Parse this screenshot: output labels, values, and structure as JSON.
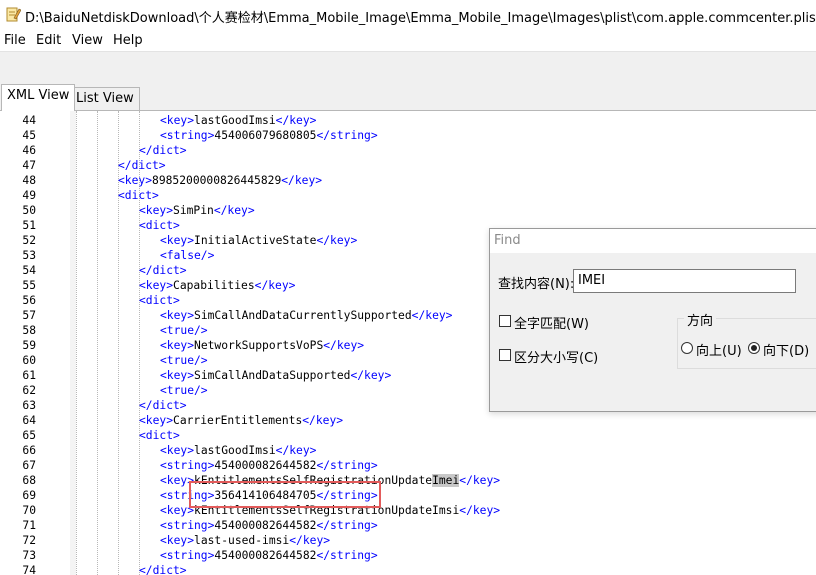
{
  "window": {
    "title": "D:\\BaiduNetdiskDownload\\个人赛检材\\Emma_Mobile_Image\\Emma_Mobile_Image\\Images\\plist\\com.apple.commcenter.plist",
    "icon": "notepad-pencil-icon"
  },
  "menu": {
    "file": "File",
    "edit": "Edit",
    "view": "View",
    "help": "Help"
  },
  "tabs": {
    "xml": "XML View",
    "list": "List View"
  },
  "editor": {
    "lines": [
      {
        "n": "44",
        "d": 3,
        "parts": [
          [
            "t",
            "<key>"
          ],
          [
            "x",
            "lastGoodImsi"
          ],
          [
            "t",
            "</key>"
          ]
        ]
      },
      {
        "n": "45",
        "d": 3,
        "parts": [
          [
            "t",
            "<string>"
          ],
          [
            "x",
            "454006079680805"
          ],
          [
            "t",
            "</string>"
          ]
        ]
      },
      {
        "n": "46",
        "d": 2,
        "parts": [
          [
            "t",
            "</dict>"
          ]
        ]
      },
      {
        "n": "47",
        "d": 1,
        "parts": [
          [
            "t",
            "</dict>"
          ]
        ]
      },
      {
        "n": "48",
        "d": 1,
        "parts": [
          [
            "t",
            "<key>"
          ],
          [
            "x",
            "8985200000826445829"
          ],
          [
            "t",
            "</key>"
          ]
        ]
      },
      {
        "n": "49",
        "d": 1,
        "parts": [
          [
            "t",
            "<dict>"
          ]
        ]
      },
      {
        "n": "50",
        "d": 2,
        "parts": [
          [
            "t",
            "<key>"
          ],
          [
            "x",
            "SimPin"
          ],
          [
            "t",
            "</key>"
          ]
        ]
      },
      {
        "n": "51",
        "d": 2,
        "parts": [
          [
            "t",
            "<dict>"
          ]
        ]
      },
      {
        "n": "52",
        "d": 3,
        "parts": [
          [
            "t",
            "<key>"
          ],
          [
            "x",
            "InitialActiveState"
          ],
          [
            "t",
            "</key>"
          ]
        ]
      },
      {
        "n": "53",
        "d": 3,
        "parts": [
          [
            "t",
            "<false/>"
          ]
        ]
      },
      {
        "n": "54",
        "d": 2,
        "parts": [
          [
            "t",
            "</dict>"
          ]
        ]
      },
      {
        "n": "55",
        "d": 2,
        "parts": [
          [
            "t",
            "<key>"
          ],
          [
            "x",
            "Capabilities"
          ],
          [
            "t",
            "</key>"
          ]
        ]
      },
      {
        "n": "56",
        "d": 2,
        "parts": [
          [
            "t",
            "<dict>"
          ]
        ]
      },
      {
        "n": "57",
        "d": 3,
        "parts": [
          [
            "t",
            "<key>"
          ],
          [
            "x",
            "SimCallAndDataCurrentlySupported"
          ],
          [
            "t",
            "</key>"
          ]
        ]
      },
      {
        "n": "58",
        "d": 3,
        "parts": [
          [
            "t",
            "<true/>"
          ]
        ]
      },
      {
        "n": "59",
        "d": 3,
        "parts": [
          [
            "t",
            "<key>"
          ],
          [
            "x",
            "NetworkSupportsVoPS"
          ],
          [
            "t",
            "</key>"
          ]
        ]
      },
      {
        "n": "60",
        "d": 3,
        "parts": [
          [
            "t",
            "<true/>"
          ]
        ]
      },
      {
        "n": "61",
        "d": 3,
        "parts": [
          [
            "t",
            "<key>"
          ],
          [
            "x",
            "SimCallAndDataSupported"
          ],
          [
            "t",
            "</key>"
          ]
        ]
      },
      {
        "n": "62",
        "d": 3,
        "parts": [
          [
            "t",
            "<true/>"
          ]
        ]
      },
      {
        "n": "63",
        "d": 2,
        "parts": [
          [
            "t",
            "</dict>"
          ]
        ]
      },
      {
        "n": "64",
        "d": 2,
        "parts": [
          [
            "t",
            "<key>"
          ],
          [
            "x",
            "CarrierEntitlements"
          ],
          [
            "t",
            "</key>"
          ]
        ]
      },
      {
        "n": "65",
        "d": 2,
        "parts": [
          [
            "t",
            "<dict>"
          ]
        ]
      },
      {
        "n": "66",
        "d": 3,
        "parts": [
          [
            "t",
            "<key>"
          ],
          [
            "x",
            "lastGoodImsi"
          ],
          [
            "t",
            "</key>"
          ]
        ]
      },
      {
        "n": "67",
        "d": 3,
        "parts": [
          [
            "t",
            "<string>"
          ],
          [
            "x",
            "454000082644582"
          ],
          [
            "t",
            "</string>"
          ]
        ]
      },
      {
        "n": "68",
        "d": 3,
        "parts": [
          [
            "t",
            "<key>"
          ],
          [
            "x",
            "kEntitlementsSelfRegistrationUpdate"
          ],
          [
            "h",
            "Imei"
          ],
          [
            "t",
            "</key>"
          ]
        ]
      },
      {
        "n": "69",
        "d": 3,
        "parts": [
          [
            "t",
            "<string>"
          ],
          [
            "x",
            "356414106484705"
          ],
          [
            "t",
            "</string>"
          ]
        ]
      },
      {
        "n": "70",
        "d": 3,
        "parts": [
          [
            "t",
            "<key>"
          ],
          [
            "x",
            "kEntitlementsSelfRegistrationUpdateImsi"
          ],
          [
            "t",
            "</key>"
          ]
        ]
      },
      {
        "n": "71",
        "d": 3,
        "parts": [
          [
            "t",
            "<string>"
          ],
          [
            "x",
            "454000082644582"
          ],
          [
            "t",
            "</string>"
          ]
        ]
      },
      {
        "n": "72",
        "d": 3,
        "parts": [
          [
            "t",
            "<key>"
          ],
          [
            "x",
            "last-used-imsi"
          ],
          [
            "t",
            "</key>"
          ]
        ]
      },
      {
        "n": "73",
        "d": 3,
        "parts": [
          [
            "t",
            "<string>"
          ],
          [
            "x",
            "454000082644582"
          ],
          [
            "t",
            "</string>"
          ]
        ]
      },
      {
        "n": "74",
        "d": 2,
        "parts": [
          [
            "t",
            "</dict>"
          ]
        ]
      }
    ]
  },
  "find_dialog": {
    "title": "Find",
    "find_label": "查找内容(N):",
    "find_value": "IMEI",
    "match_whole_word": "全字匹配(W)",
    "match_case": "区分大小写(C)",
    "direction_label": "方向",
    "up": "向上(U)",
    "down": "向下(D)",
    "selected_direction": "down"
  }
}
